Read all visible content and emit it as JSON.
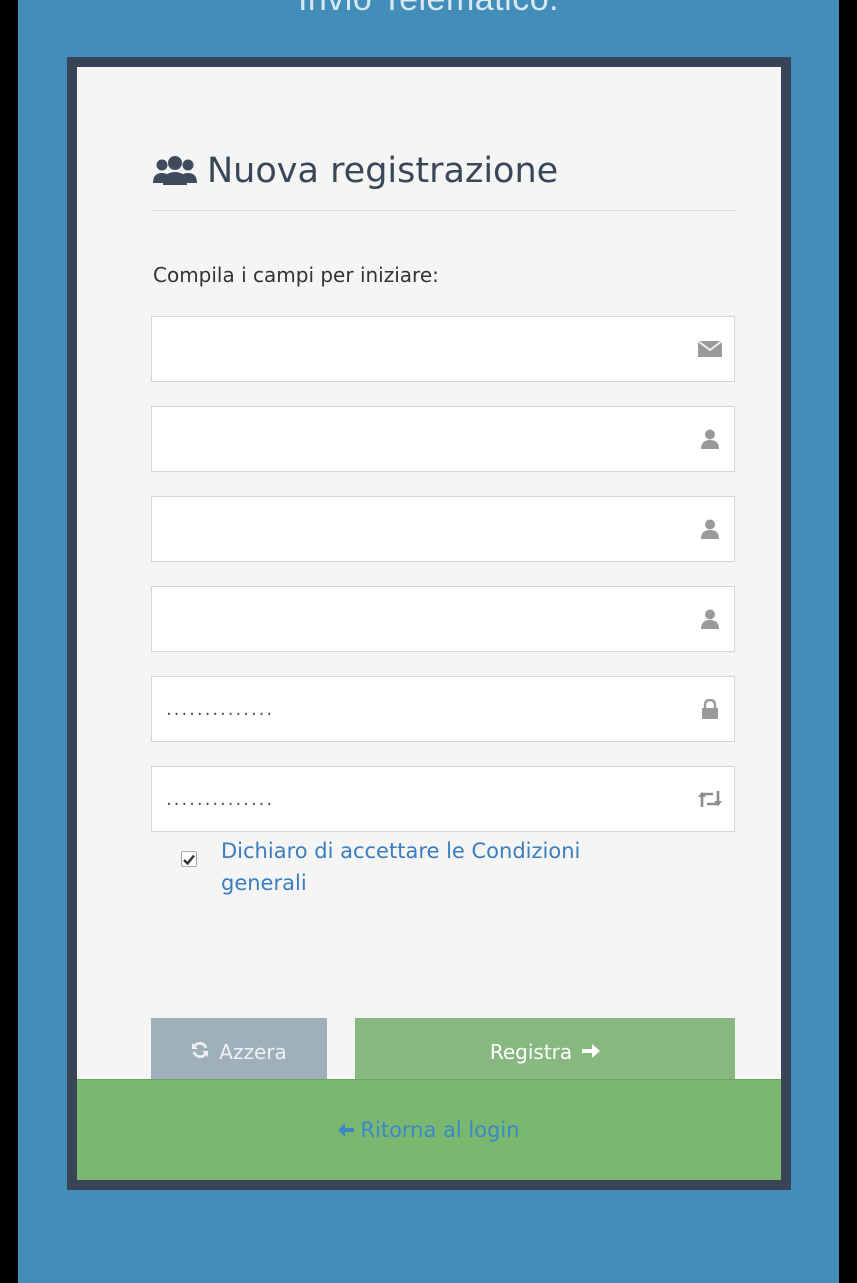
{
  "header": {
    "top_text": "Invio Telematico."
  },
  "form": {
    "title": "Nuova registrazione",
    "instructions": "Compila i campi per iniziare:",
    "fields": [
      {
        "value": "",
        "icon": "envelope-icon"
      },
      {
        "value": "",
        "icon": "user-icon"
      },
      {
        "value": "",
        "icon": "user-icon"
      },
      {
        "value": "",
        "icon": "user-icon"
      },
      {
        "value": "..............",
        "icon": "lock-icon"
      },
      {
        "value": "..............",
        "icon": "retweet-icon"
      }
    ],
    "terms": {
      "checked": true,
      "label": "Dichiaro di accettare le Condizioni generali"
    },
    "reset_label": "Azzera",
    "submit_label": "Registra"
  },
  "footer": {
    "back_label": "Ritorna al login"
  },
  "colors": {
    "page_background": "#438EB9",
    "card_border": "#394557",
    "card_background": "#f5f5f5",
    "reset_button": "#A0B0BB",
    "submit_button": "#87B87F",
    "footer_bar": "#7ab870",
    "link": "#3a7ebf"
  }
}
